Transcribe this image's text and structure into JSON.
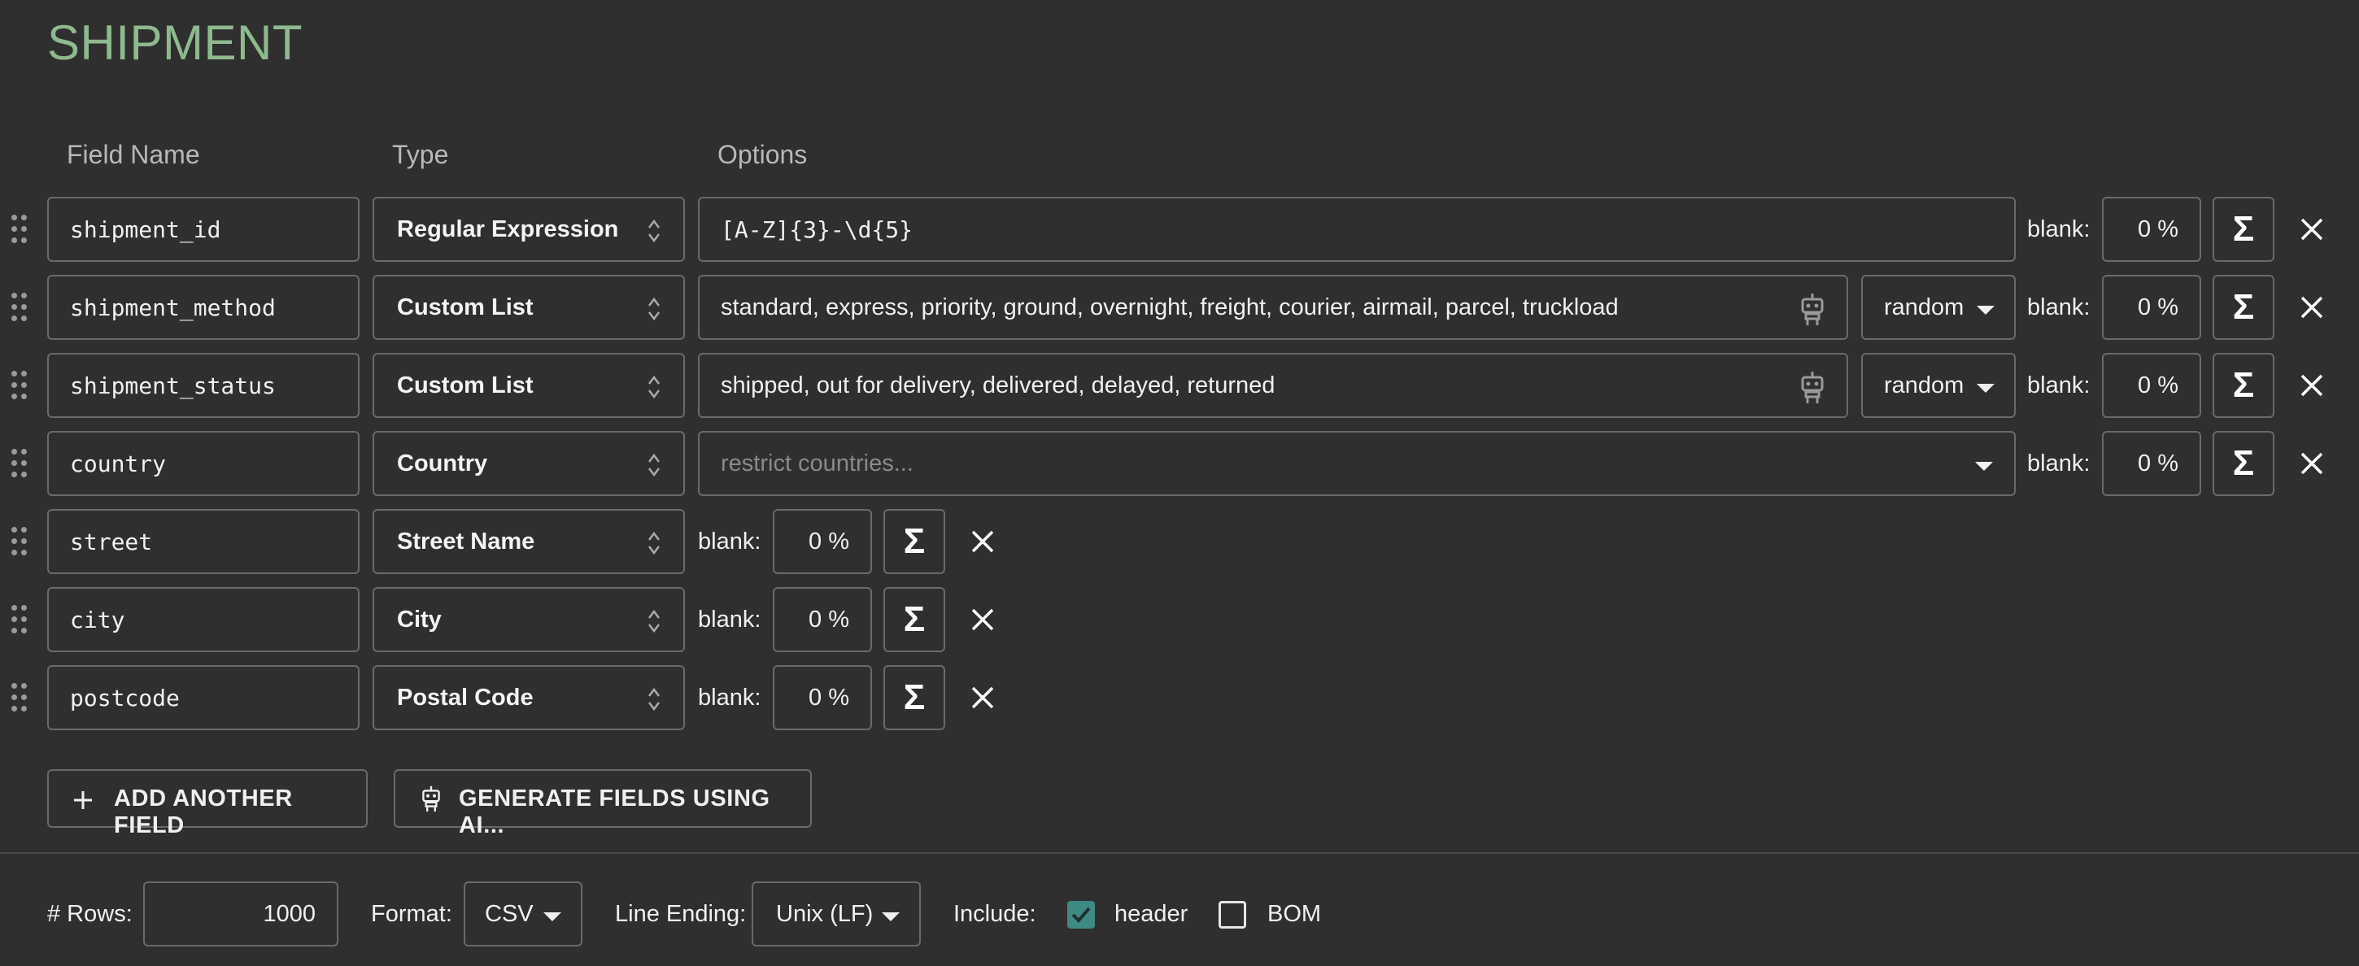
{
  "page": {
    "title": "SHIPMENT"
  },
  "columns": {
    "field_name": "Field Name",
    "type": "Type",
    "options": "Options"
  },
  "blank_label": "blank:",
  "fields": [
    {
      "name": "shipment_id",
      "type": "Regular Expression",
      "options_value": "[A-Z]{3}-\\d{5}",
      "blank_pct": "0 %"
    },
    {
      "name": "shipment_method",
      "type": "Custom List",
      "options_value": "standard, express, priority, ground, overnight, freight, courier, airmail, parcel, truckload",
      "order": "random",
      "blank_pct": "0 %"
    },
    {
      "name": "shipment_status",
      "type": "Custom List",
      "options_value": "shipped, out for delivery, delivered, delayed, returned",
      "order": "random",
      "blank_pct": "0 %"
    },
    {
      "name": "country",
      "type": "Country",
      "options_placeholder": "restrict countries...",
      "blank_pct": "0 %"
    },
    {
      "name": "street",
      "type": "Street Name",
      "blank_pct": "0 %"
    },
    {
      "name": "city",
      "type": "City",
      "blank_pct": "0 %"
    },
    {
      "name": "postcode",
      "type": "Postal Code",
      "blank_pct": "0 %"
    }
  ],
  "actions": {
    "add_field": "ADD ANOTHER FIELD",
    "generate_ai": "GENERATE FIELDS USING AI..."
  },
  "footer": {
    "rows_label": "# Rows:",
    "rows_value": "1000",
    "format_label": "Format:",
    "format_value": "CSV",
    "line_ending_label": "Line Ending:",
    "line_ending_value": "Unix (LF)",
    "include_label": "Include:",
    "header_label": "header",
    "header_checked": true,
    "bom_label": "BOM",
    "bom_checked": false
  },
  "colors": {
    "accent_title": "#8fb98f",
    "checkbox_checked": "#3f8a82",
    "background": "#2f2f2f"
  },
  "icons": [
    "drag-handle-icon",
    "updown-arrows-icon",
    "robot-icon",
    "sigma-icon",
    "close-icon",
    "plus-icon",
    "caret-down-icon",
    "checkmark-icon"
  ]
}
